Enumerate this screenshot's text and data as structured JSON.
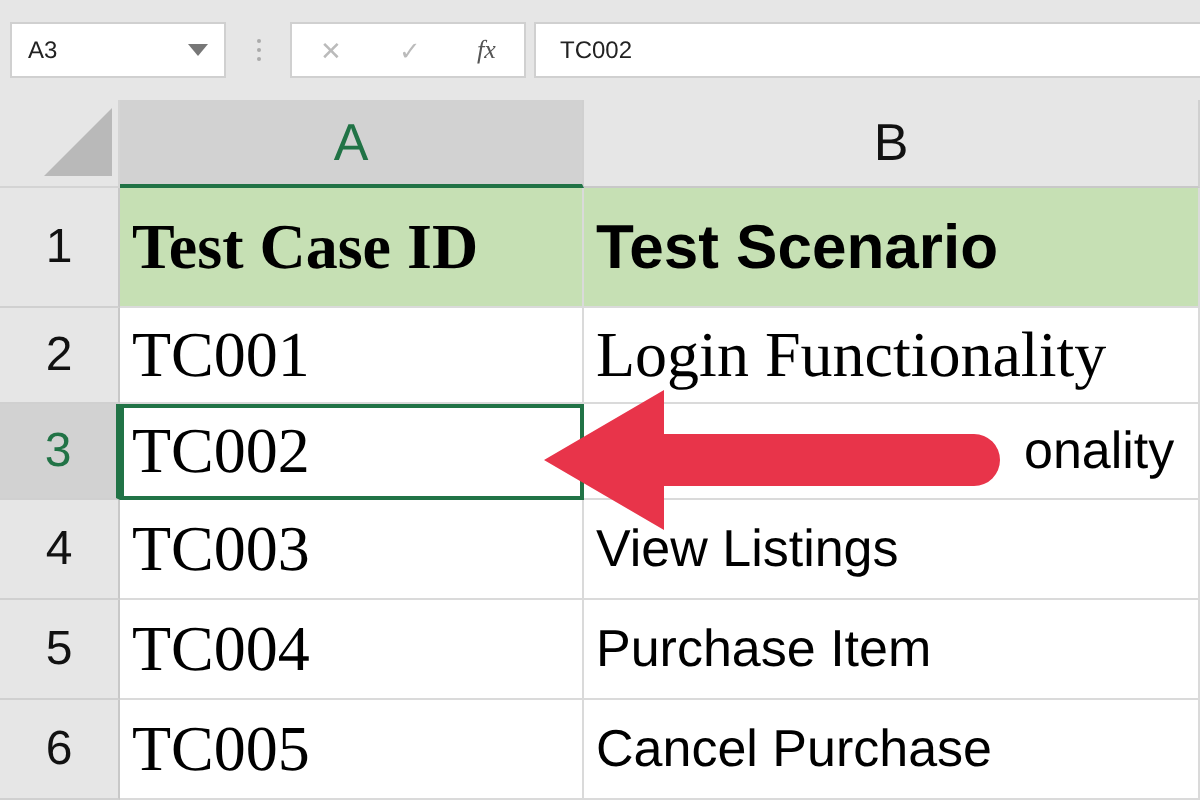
{
  "name_box": {
    "value": "A3"
  },
  "formula_bar": {
    "cancel": "✕",
    "enter": "✓",
    "function": "fx",
    "value": "TC002"
  },
  "columns": [
    {
      "label": "A",
      "selected": true
    },
    {
      "label": "B",
      "selected": false
    }
  ],
  "rows": [
    {
      "number": "1",
      "selected": false,
      "header": true,
      "cells": [
        {
          "text": "Test Case ID",
          "kind": "serif",
          "selected": false
        },
        {
          "text": "Test Scenario",
          "kind": "sans",
          "selected": false
        }
      ]
    },
    {
      "number": "2",
      "selected": false,
      "header": false,
      "cells": [
        {
          "text": "TC001",
          "kind": "serif",
          "selected": false
        },
        {
          "text": "Login Functionality",
          "kind": "serif",
          "selected": false
        }
      ]
    },
    {
      "number": "3",
      "selected": true,
      "header": false,
      "cells": [
        {
          "text": "TC002",
          "kind": "serif",
          "selected": true
        },
        {
          "text": "onality",
          "kind": "fragment",
          "selected": false
        }
      ]
    },
    {
      "number": "4",
      "selected": false,
      "header": false,
      "cells": [
        {
          "text": "TC003",
          "kind": "serif",
          "selected": false
        },
        {
          "text": "View Listings",
          "kind": "sans",
          "selected": false
        }
      ]
    },
    {
      "number": "5",
      "selected": false,
      "header": false,
      "cells": [
        {
          "text": "TC004",
          "kind": "serif",
          "selected": false
        },
        {
          "text": "Purchase Item",
          "kind": "sans",
          "selected": false
        }
      ]
    },
    {
      "number": "6",
      "selected": false,
      "header": false,
      "cells": [
        {
          "text": "TC005",
          "kind": "serif",
          "selected": false
        },
        {
          "text": "Cancel Purchase",
          "kind": "sans",
          "selected": false
        }
      ]
    }
  ]
}
